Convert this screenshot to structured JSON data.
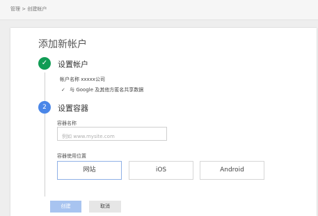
{
  "breadcrumb": "管理 > 创建帐户",
  "title": "添加新帐户",
  "step1": {
    "icon": "✓",
    "title": "设置帐户",
    "account_label": "帐户名称",
    "account_value": "xxxxx公司",
    "share_check": "✓",
    "share_text": "与 Google 及其他方匿名共享数据"
  },
  "step2": {
    "number": "2",
    "title": "设置容器",
    "container_name_label": "容器名称",
    "container_name_placeholder": "例如 www.mysite.com",
    "container_name_value": "",
    "usage_label": "容器使用位置",
    "options": [
      "网站",
      "iOS",
      "Android"
    ]
  },
  "buttons": {
    "create": "创建",
    "cancel": "取消"
  }
}
